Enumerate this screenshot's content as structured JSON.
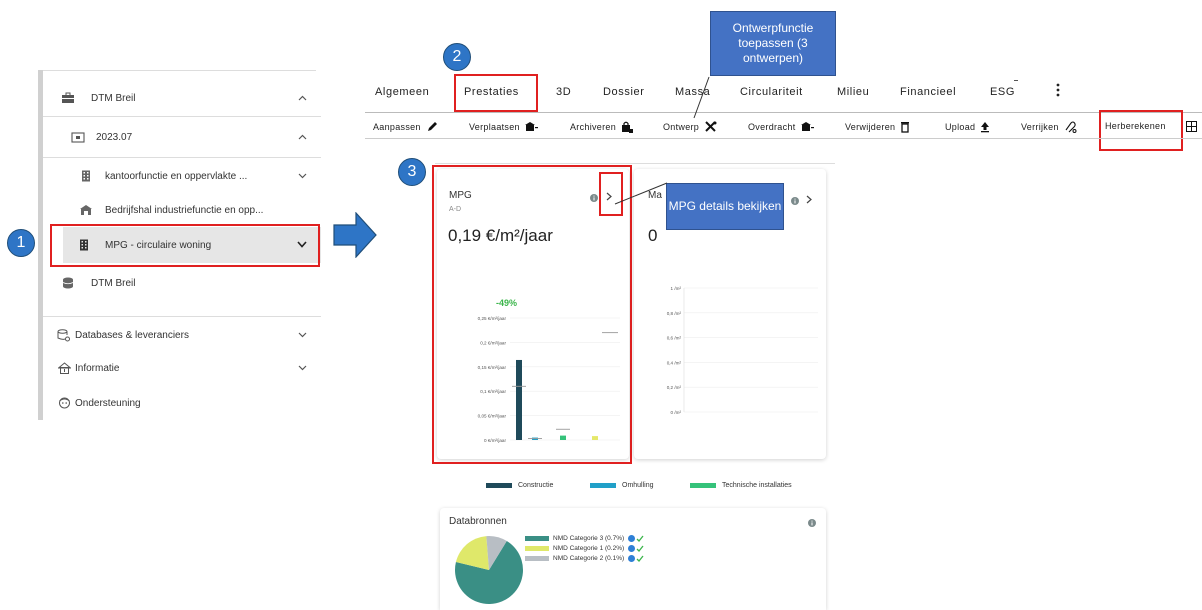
{
  "sidebar": {
    "items": [
      {
        "label": "DTM Breil",
        "icon": "briefcase-icon",
        "chevron": "⌃"
      },
      {
        "label": "2023.07",
        "icon": "folder-icon",
        "chevron": "⌃"
      },
      {
        "label": "kantoorfunctie en oppervlakte ...",
        "icon": "building-icon",
        "chevron": "⌄"
      },
      {
        "label": "Bedrijfshal industriefunctie en opp...",
        "icon": "warehouse-icon",
        "chevron": ""
      },
      {
        "label": "MPG - circulaire woning",
        "icon": "building-icon",
        "chevron": "⌄"
      },
      {
        "label": "DTM Breil",
        "icon": "database-icon",
        "chevron": ""
      },
      {
        "label": "Databases & leveranciers",
        "icon": "database-settings-icon",
        "chevron": "⌄"
      },
      {
        "label": "Informatie",
        "icon": "home-info-icon",
        "chevron": "⌄"
      },
      {
        "label": "Ondersteuning",
        "icon": "support-icon",
        "chevron": ""
      }
    ]
  },
  "steps": [
    "1",
    "2",
    "3"
  ],
  "tabs": [
    "Algemeen",
    "Prestaties",
    "3D",
    "Dossier",
    "Massa",
    "Circulariteit",
    "Milieu",
    "Financieel",
    "ESG"
  ],
  "toolbar": [
    {
      "label": "Aanpassen",
      "icon": "pencil-icon"
    },
    {
      "label": "Verplaatsen",
      "icon": "move-building-icon"
    },
    {
      "label": "Archiveren",
      "icon": "archive-lock-icon"
    },
    {
      "label": "Ontwerp",
      "icon": "tools-icon"
    },
    {
      "label": "Overdracht",
      "icon": "transfer-building-icon"
    },
    {
      "label": "Verwijderen",
      "icon": "trash-icon"
    },
    {
      "label": "Upload",
      "icon": "upload-icon"
    },
    {
      "label": "Verrijken",
      "icon": "enrich-icon"
    },
    {
      "label": "Herberekenen",
      "icon": "calculator-icon"
    }
  ],
  "callouts": {
    "ontwerp": "Ontwerpfunctie toepassen (3 ontwerpen)",
    "mpg": "MPG details bekijken"
  },
  "mpg_card": {
    "title": "MPG",
    "subtitle": "A-D",
    "value": "0,19 €/m²/jaar",
    "delta": "-49%"
  },
  "second_card": {
    "title": "Ma",
    "value": "0"
  },
  "chart_data": [
    {
      "type": "bar",
      "categories": [
        "Constructie",
        "Omhulling",
        "Technische installaties",
        "Overig"
      ],
      "values": [
        0.164,
        0.005,
        0.009,
        0.008
      ],
      "reference_values": [
        0.11,
        0.003,
        0.022,
        0.0
      ],
      "target_line": 0.22,
      "yticks": [
        "0,25 €/m²/jaar",
        "0,2 €/m²/jaar",
        "0,15 €/m²/jaar",
        "0,1 €/m²/jaar",
        "0,05 €/m²/jaar",
        "0 €/m²/jaar"
      ],
      "ylim": [
        0,
        0.25
      ],
      "colors": [
        "#1f4a5a",
        "#21a0c8",
        "#35c27a",
        "#e5e86a"
      ]
    },
    {
      "type": "bar",
      "yticks": [
        "1 /m²",
        "0,8 /m²",
        "0,6 /m²",
        "0,4 /m²",
        "0,2 /m²",
        "0 /m²"
      ],
      "ylim": [
        0,
        1
      ],
      "values": []
    }
  ],
  "legend": [
    {
      "label": "Constructie",
      "color": "#1f4a5a"
    },
    {
      "label": "Omhulling",
      "color": "#21a0c8"
    },
    {
      "label": "Technische installaties",
      "color": "#35c27a"
    }
  ],
  "databronnen": {
    "title": "Databronnen",
    "items": [
      {
        "label": "NMD Categorie 3 (0.7%)",
        "color": "#3a8f85",
        "share": 0.7
      },
      {
        "label": "NMD Categorie 1 (0.2%)",
        "color": "#dfe86a",
        "share": 0.2
      },
      {
        "label": "NMD Categorie 2 (0.1%)",
        "color": "#b8bec4",
        "share": 0.1
      }
    ]
  }
}
